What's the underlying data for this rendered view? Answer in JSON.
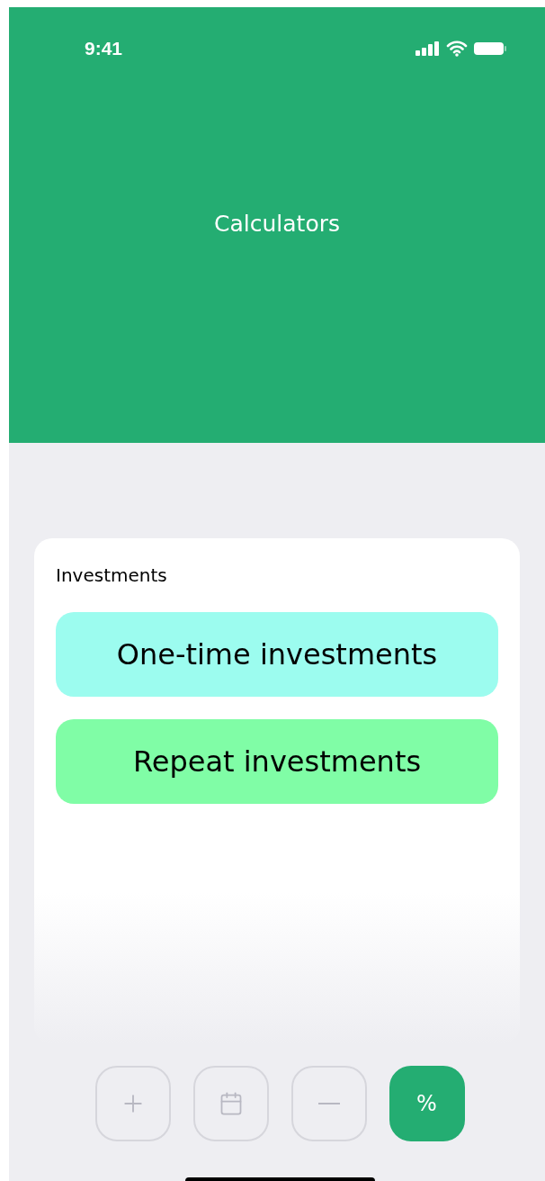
{
  "status_bar": {
    "time": "9:41"
  },
  "header": {
    "title": "Calculators"
  },
  "card": {
    "title": "Investments",
    "options": [
      {
        "label": "One-time investments",
        "color": "#9cfcef"
      },
      {
        "label": "Repeat investments",
        "color": "#80fda6"
      }
    ]
  },
  "tab_bar": [
    {
      "kind": "plus",
      "selected": false
    },
    {
      "kind": "calendar",
      "selected": false
    },
    {
      "kind": "minus",
      "selected": false
    },
    {
      "kind": "text",
      "label": "%",
      "selected": true
    }
  ]
}
